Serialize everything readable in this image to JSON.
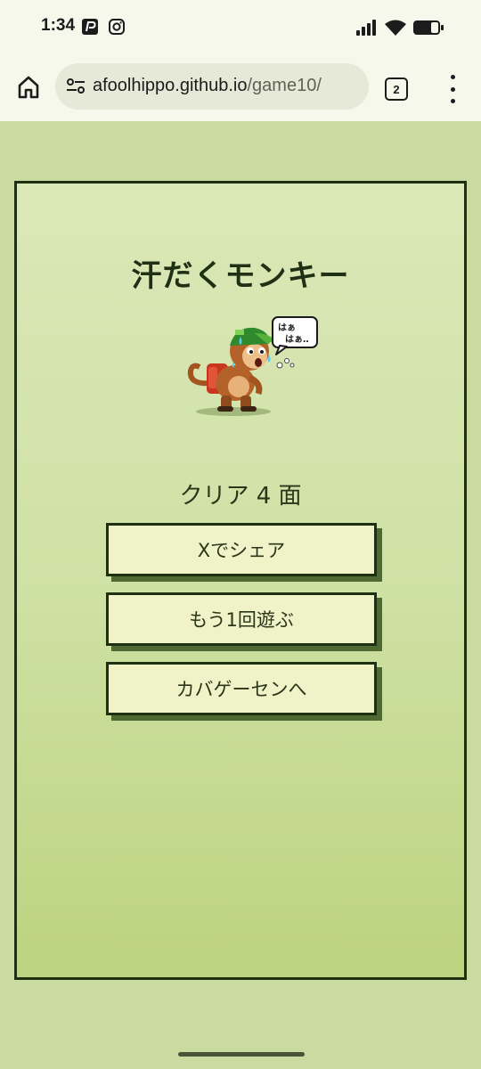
{
  "status_bar": {
    "time": "1:34",
    "apps": [
      "paypay-icon",
      "instagram-icon"
    ],
    "indicators": [
      "cellular-signal-icon",
      "wifi-icon",
      "battery-icon"
    ]
  },
  "browser": {
    "url_host": "afoolhippo.github.io",
    "url_path": "/game10/",
    "tab_count": "2"
  },
  "game": {
    "title": "汗だくモンキー",
    "speech_line1": "はぁ",
    "speech_line2": "はぁ‥",
    "clear_text": "クリア 4 面",
    "buttons": {
      "share": "Xでシェア",
      "retry": "もう1回遊ぶ",
      "gamecenter": "カバゲーセンへ"
    }
  },
  "colors": {
    "background": "#c9dba0",
    "panel_border": "#1e2f12",
    "button_fill": "#f0f2c7",
    "button_shadow": "#4f6932"
  }
}
